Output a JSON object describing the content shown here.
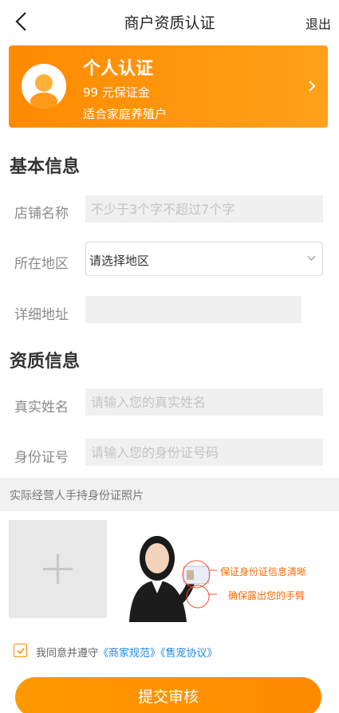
{
  "nav": {
    "title": "商户资质认证",
    "logout": "退出"
  },
  "banner": {
    "title": "个人认证",
    "line1": "99 元保证金",
    "line2": "适合家庭养殖户"
  },
  "basic": {
    "title": "基本信息",
    "store_name": {
      "label": "店铺名称",
      "placeholder": "不少于3个字不超过7个字"
    },
    "region": {
      "label": "所在地区",
      "value": "请选择地区"
    },
    "address": {
      "label": "详细地址",
      "placeholder": ""
    }
  },
  "qualification": {
    "title": "资质信息",
    "real_name": {
      "label": "真实姓名",
      "placeholder": "请输入您的真实姓名"
    },
    "id_number": {
      "label": "身份证号",
      "placeholder": "请输入您的身份证号码"
    }
  },
  "photo": {
    "heading": "实际经营人手持身份证照片",
    "tip1": "保证身份证信息清晰",
    "tip2": "确保露出您的手臂"
  },
  "agreement": {
    "prefix": "我同意并遵守",
    "link1": "《商家规范》",
    "link2": "《售宠协议》",
    "checked": true
  },
  "submit": {
    "label": "提交审核"
  },
  "colors": {
    "accent": "#ff8a00",
    "link": "#1e88e5",
    "tip": "#ff6a00"
  }
}
